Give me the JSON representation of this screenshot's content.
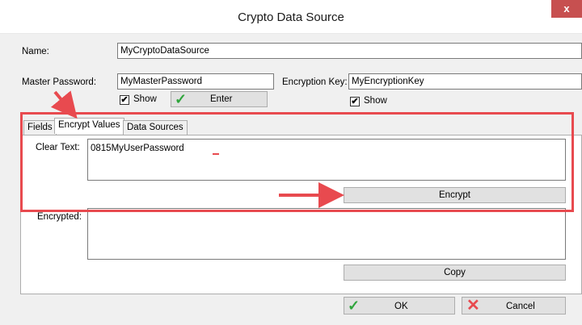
{
  "window": {
    "title": "Crypto Data Source",
    "close_glyph": "x"
  },
  "name": {
    "label": "Name:",
    "value": "MyCryptoDataSource"
  },
  "master_password": {
    "label": "Master Password:",
    "value": "MyMasterPassword",
    "show_label": "Show",
    "show_checked": true,
    "enter_label": "Enter"
  },
  "encryption_key": {
    "label": "Encryption Key:",
    "value": "MyEncryptionKey",
    "show_label": "Show",
    "show_checked": true
  },
  "tabs": [
    {
      "label": "Fields",
      "active": false
    },
    {
      "label": "Encrypt Values",
      "active": true
    },
    {
      "label": "Data Sources",
      "active": false
    }
  ],
  "encrypt": {
    "clear_text_label": "Clear Text:",
    "clear_text_value": "0815MyUserPassword",
    "encrypt_button": "Encrypt",
    "encrypted_label": "Encrypted:",
    "encrypted_value": "",
    "copy_button": "Copy"
  },
  "footer": {
    "ok_label": "OK",
    "cancel_label": "Cancel"
  },
  "colors": {
    "annotation": "#e84a4f",
    "ok_check": "#2fa53c",
    "cancel_x": "#e84a4f"
  },
  "icons": {
    "check": "✔",
    "checkmark_ok": "✓",
    "cancel": "✕"
  }
}
